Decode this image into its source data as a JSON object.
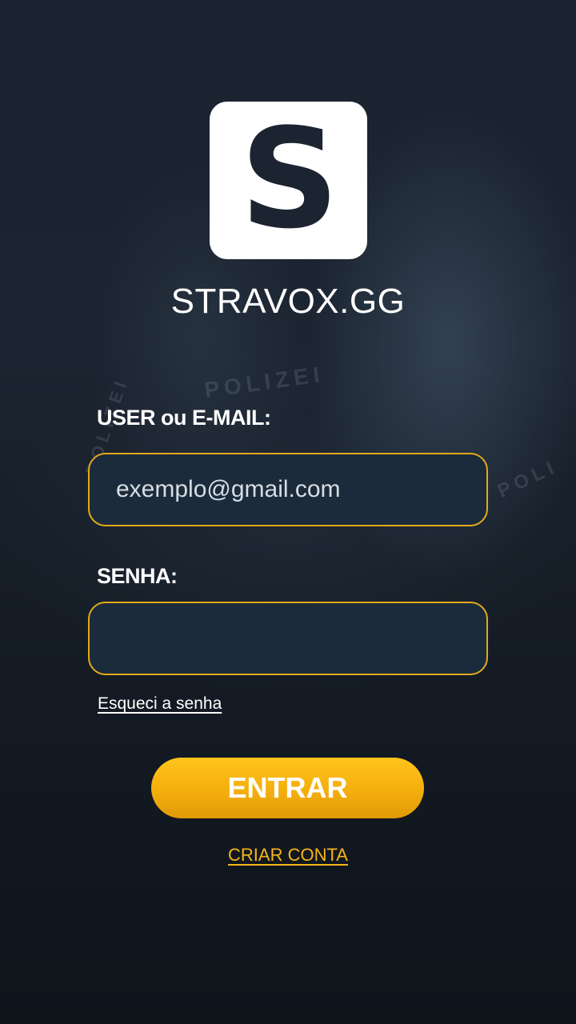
{
  "brand": {
    "logo_letter": "S",
    "name": "STRAVOX.GG"
  },
  "background": {
    "texts": [
      "POLIZEI",
      "POLIZEI",
      "POLI"
    ]
  },
  "login_form": {
    "user_label": "USER ou E-MAIL:",
    "user_placeholder": "exemplo@gmail.com",
    "user_value": "",
    "password_label": "SENHA:",
    "password_value": "",
    "forgot_password_label": "Esqueci a senha",
    "submit_label": "ENTRAR",
    "create_account_label": "CRIAR CONTA"
  },
  "colors": {
    "accent": "#f5b51a",
    "input_border": "#e2a91a",
    "input_background": "#1c2b3b",
    "page_background": "#141b24",
    "logo_letter": "#1b2430"
  }
}
